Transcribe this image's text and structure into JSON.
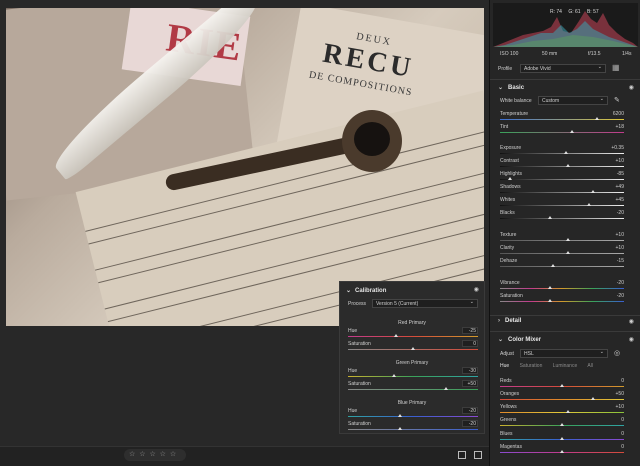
{
  "calibration": {
    "title": "Calibration",
    "process_label": "Process",
    "process_value": "Version 5 (Current)",
    "sections": [
      {
        "title": "Red Primary",
        "rows": [
          {
            "label": "Hue",
            "value": "-25",
            "pos": 0.37,
            "gradient": "linear-gradient(90deg,#c23b8c,#d44b3a,#d19a2c)"
          },
          {
            "label": "Saturation",
            "value": "0",
            "pos": 0.5,
            "gradient": "linear-gradient(90deg,#888,#d44b3a)"
          }
        ]
      },
      {
        "title": "Green Primary",
        "rows": [
          {
            "label": "Hue",
            "value": "-30",
            "pos": 0.35,
            "gradient": "linear-gradient(90deg,#c9b22f,#3aa25a,#2fa3a3)"
          },
          {
            "label": "Saturation",
            "value": "+50",
            "pos": 0.75,
            "gradient": "linear-gradient(90deg,#888,#3aa25a)"
          }
        ]
      },
      {
        "title": "Blue Primary",
        "rows": [
          {
            "label": "Hue",
            "value": "-20",
            "pos": 0.4,
            "gradient": "linear-gradient(90deg,#2fa3a3,#3a5fd0,#8a4ad0)"
          },
          {
            "label": "Saturation",
            "value": "-20",
            "pos": 0.4,
            "gradient": "linear-gradient(90deg,#888,#3a5fd0)"
          }
        ]
      }
    ]
  },
  "histogram": {
    "readout": [
      "R: 74",
      "G: 61",
      "B: 57"
    ]
  },
  "exif": {
    "iso": "ISO 100",
    "focal": "50 mm",
    "aperture": "f/13.5",
    "shutter": "1/4s"
  },
  "profile": {
    "label": "Profile",
    "value": "Adobe Vivid"
  },
  "basic": {
    "title": "Basic",
    "wb_label": "White balance",
    "wb_value": "Custom",
    "rows": [
      {
        "label": "Temperature",
        "value": "6200",
        "pos": 0.78,
        "gradient": "linear-gradient(90deg,#3b6fd3,#e0c83a)"
      },
      {
        "label": "Tint",
        "value": "+18",
        "pos": 0.58,
        "gradient": "linear-gradient(90deg,#3aa25a,#c23b8c)"
      },
      {
        "label": "Exposure",
        "value": "+0.35",
        "pos": 0.53,
        "gradient": "linear-gradient(90deg,#111,#eee)"
      },
      {
        "label": "Contrast",
        "value": "+10",
        "pos": 0.55,
        "gradient": "linear-gradient(90deg,#111,#eee)"
      },
      {
        "label": "Highlights",
        "value": "-85",
        "pos": 0.08,
        "gradient": "linear-gradient(90deg,#111,#eee)"
      },
      {
        "label": "Shadows",
        "value": "+49",
        "pos": 0.75,
        "gradient": "linear-gradient(90deg,#111,#eee)"
      },
      {
        "label": "Whites",
        "value": "+45",
        "pos": 0.72,
        "gradient": "linear-gradient(90deg,#111,#eee)"
      },
      {
        "label": "Blacks",
        "value": "-20",
        "pos": 0.4,
        "gradient": "linear-gradient(90deg,#111,#eee)"
      },
      {
        "label": "Texture",
        "value": "+10",
        "pos": 0.55,
        "gradient": "linear-gradient(90deg,#555,#aaa)"
      },
      {
        "label": "Clarity",
        "value": "+10",
        "pos": 0.55,
        "gradient": "linear-gradient(90deg,#555,#aaa)"
      },
      {
        "label": "Dehaze",
        "value": "-15",
        "pos": 0.43,
        "gradient": "linear-gradient(90deg,#555,#aaa)"
      },
      {
        "label": "Vibrance",
        "value": "-20",
        "pos": 0.4,
        "gradient": "linear-gradient(90deg,#888,#c23b8c,#d19a2c,#3aa25a,#3a5fd0)"
      },
      {
        "label": "Saturation",
        "value": "-20",
        "pos": 0.4,
        "gradient": "linear-gradient(90deg,#888,#c23b8c,#d19a2c,#3aa25a,#3a5fd0)"
      }
    ]
  },
  "detail": {
    "title": "Detail"
  },
  "color_mixer": {
    "title": "Color Mixer",
    "adjust_label": "Adjust",
    "adjust_value": "HSL",
    "tabs": [
      "Hue",
      "Saturation",
      "Luminance",
      "All"
    ],
    "rows": [
      {
        "label": "Reds",
        "value": "0",
        "pos": 0.5,
        "gradient": "linear-gradient(90deg,#c23b8c,#d44b3a,#d19a2c)"
      },
      {
        "label": "Oranges",
        "value": "+50",
        "pos": 0.75,
        "gradient": "linear-gradient(90deg,#d44b3a,#e08a2a,#e0c83a)"
      },
      {
        "label": "Yellows",
        "value": "+10",
        "pos": 0.55,
        "gradient": "linear-gradient(90deg,#e08a2a,#e0c83a,#8ac23a)"
      },
      {
        "label": "Greens",
        "value": "0",
        "pos": 0.5,
        "gradient": "linear-gradient(90deg,#c9b22f,#3aa25a,#2fa3a3)"
      },
      {
        "label": "Blues",
        "value": "0",
        "pos": 0.5,
        "gradient": "linear-gradient(90deg,#2fa3a3,#3a5fd0,#8a4ad0)"
      },
      {
        "label": "Magentas",
        "value": "0",
        "pos": 0.5,
        "gradient": "linear-gradient(90deg,#8a4ad0,#c23b8c,#d44b3a)"
      }
    ]
  },
  "photo": {
    "sheet_title_text": "RIE",
    "sheet2_line1": "DEUX",
    "sheet2_line2": "RECU",
    "sheet2_line3": "DE COMPOSITIONS"
  },
  "rating": {
    "stars": "☆ ☆ ☆ ☆ ☆"
  }
}
